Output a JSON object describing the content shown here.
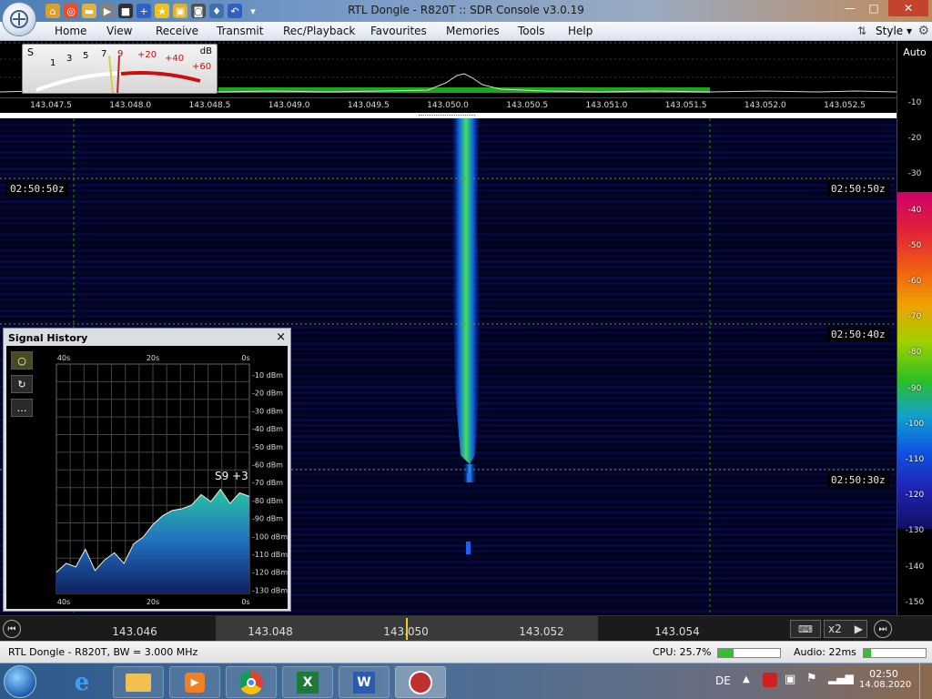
{
  "window": {
    "title": "RTL Dongle - R820T :: SDR Console v3.0.19"
  },
  "quick_access": [
    {
      "icon": "home-icon",
      "color": "#d8a030"
    },
    {
      "icon": "lifebuoy-icon",
      "color": "#e05030"
    },
    {
      "icon": "folder-icon",
      "color": "#e0b040"
    },
    {
      "icon": "play-icon",
      "color": "#808080"
    },
    {
      "icon": "stop-icon",
      "color": "#303030"
    },
    {
      "icon": "plus-icon",
      "color": "#3060c0"
    },
    {
      "icon": "star-icon",
      "color": "#f0c020"
    },
    {
      "icon": "lock-icon",
      "color": "#e0b030"
    },
    {
      "icon": "camera-icon",
      "color": "#505050"
    },
    {
      "icon": "pin-icon",
      "color": "#4070b0"
    },
    {
      "icon": "undo-icon",
      "color": "#3060c0"
    }
  ],
  "menu": {
    "items": [
      "Home",
      "View",
      "Receive",
      "Transmit",
      "Rec/Playback",
      "Favourites",
      "Memories",
      "Tools",
      "Help"
    ],
    "style_label": "Style"
  },
  "smeter": {
    "s_label": "S",
    "db_label": "dB",
    "s_ticks": [
      "1",
      "3",
      "5",
      "7",
      "9"
    ],
    "db_ticks": [
      "+20",
      "+40",
      "+60"
    ]
  },
  "spectrum": {
    "freq_labels": [
      "143.047.5",
      "143.048.0",
      "143.048.5",
      "143.049.0",
      "143.049.5",
      "143.050.0",
      "143.050.5",
      "143.051.0",
      "143.051.5",
      "143.052.0",
      "143.052.5"
    ]
  },
  "waterfall": {
    "time_labels": [
      "02:50:50z",
      "02:50:40z",
      "02:50:30z"
    ]
  },
  "db_scale": {
    "auto_label": "Auto",
    "ticks": [
      "-10",
      "-20",
      "-30",
      "-40",
      "-50",
      "-60",
      "-70",
      "-80",
      "-90",
      "-100",
      "-110",
      "-120",
      "-130",
      "-140",
      "-150"
    ],
    "colors": [
      "#d0006a",
      "#e0203a",
      "#f05a14",
      "#f0a000",
      "#a0d000",
      "#30c020",
      "#10a0d0",
      "#1050e0",
      "#2020b0",
      "#101060"
    ]
  },
  "signal_history": {
    "title": "Signal History",
    "close_label": "×",
    "buttons": [
      "○",
      "↻",
      "…"
    ],
    "top_time_labels": [
      "40s",
      "20s",
      "0s"
    ],
    "bottom_time_labels": [
      "40s",
      "20s",
      "0s"
    ],
    "dbm_labels": [
      "-10 dBm",
      "-20 dBm",
      "-30 dBm",
      "-40 dBm",
      "-50 dBm",
      "-60 dBm",
      "-70 dBm",
      "-80 dBm",
      "-90 dBm",
      "-100 dBm",
      "-110 dBm",
      "-120 dBm",
      "-130 dBm"
    ],
    "reading": "S9 +3"
  },
  "chart_data": {
    "type": "area",
    "title": "",
    "xlabel": "",
    "ylabel": "",
    "x_ticks": [
      "40s",
      "20s",
      "0s"
    ],
    "ylim": [
      -135,
      -5
    ],
    "series": [
      {
        "x": [
          40,
          38,
          36,
          34,
          32,
          30,
          28,
          26,
          24,
          22,
          20,
          18,
          16,
          14,
          12,
          10,
          8,
          6,
          4,
          2,
          0
        ],
        "values": [
          -123,
          -118,
          -120,
          -110,
          -122,
          -116,
          -112,
          -118,
          -107,
          -103,
          -96,
          -91,
          -88,
          -87,
          -85,
          -79,
          -83,
          -76,
          -84,
          -78,
          -80
        ]
      }
    ]
  },
  "tuning": {
    "freq_labels": [
      "143.046",
      "143.048",
      "143.050",
      "143.052",
      "143.054"
    ],
    "zoom_label": "x2"
  },
  "status": {
    "device": "RTL Dongle - R820T, BW = 3.000 MHz",
    "cpu": "CPU: 25.7%",
    "cpu_fraction": 0.257,
    "audio": "Audio: 22ms",
    "audio_fraction": 0.12
  },
  "taskbar": {
    "apps": [
      "windows-start-icon",
      "internet-explorer-icon",
      "file-explorer-icon",
      "media-player-icon",
      "chrome-icon",
      "excel-icon",
      "word-icon",
      "sdr-console-icon"
    ],
    "lang": "DE",
    "time": "02:50",
    "date": "14.08.2020"
  }
}
